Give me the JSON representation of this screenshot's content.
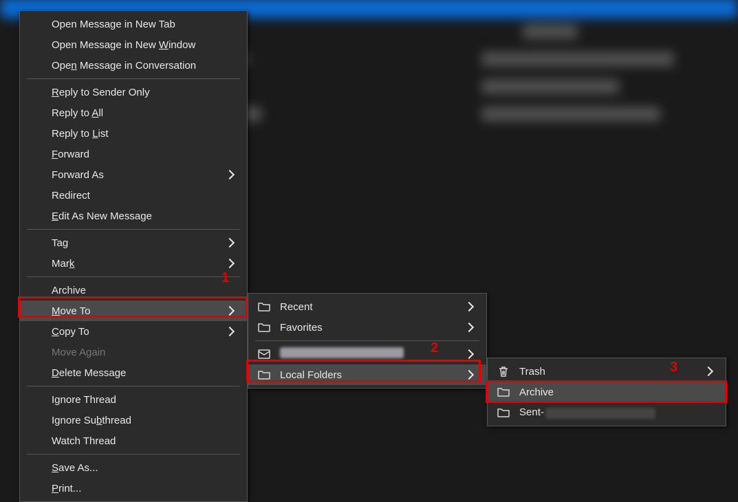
{
  "menu1": {
    "open_tab": "Open Message in New Tab",
    "open_window_pre": "Open Message in New ",
    "open_window_u": "W",
    "open_window_post": "indow",
    "open_conv_pre": "Ope",
    "open_conv_u": "n",
    "open_conv_post": " Message in Conversation",
    "reply_sender_u": "R",
    "reply_sender_post": "eply to Sender Only",
    "reply_all_pre": "Reply to ",
    "reply_all_u": "A",
    "reply_all_post": "ll",
    "reply_list_pre": "Reply to ",
    "reply_list_u": "L",
    "reply_list_post": "ist",
    "forward_u": "F",
    "forward_post": "orward",
    "forward_as": "Forward As",
    "redirect": "Redirect",
    "edit_new_u": "E",
    "edit_new_post": "dit As New Message",
    "tag": "Tag",
    "mark_pre": "Mar",
    "mark_u": "k",
    "archive": "Archive",
    "move_to_u": "M",
    "move_to_post": "ove To",
    "copy_to_u": "C",
    "copy_to_post": "opy To",
    "move_again": "Move Again",
    "delete_u": "D",
    "delete_post": "elete Message",
    "ignore_thread": "Ignore Thread",
    "ignore_sub_pre": "Ignore Su",
    "ignore_sub_u": "b",
    "ignore_sub_post": "thread",
    "watch_thread": "Watch Thread",
    "save_as_u": "S",
    "save_as_post": "ave As...",
    "print_u": "P",
    "print_post": "rint..."
  },
  "menu2": {
    "recent": "Recent",
    "favorites": "Favorites",
    "local_folders": "Local Folders"
  },
  "menu3": {
    "trash": "Trash",
    "archive": "Archive",
    "sent": "Sent-"
  },
  "annotations": {
    "n1": "1",
    "n2": "2",
    "n3": "3"
  }
}
